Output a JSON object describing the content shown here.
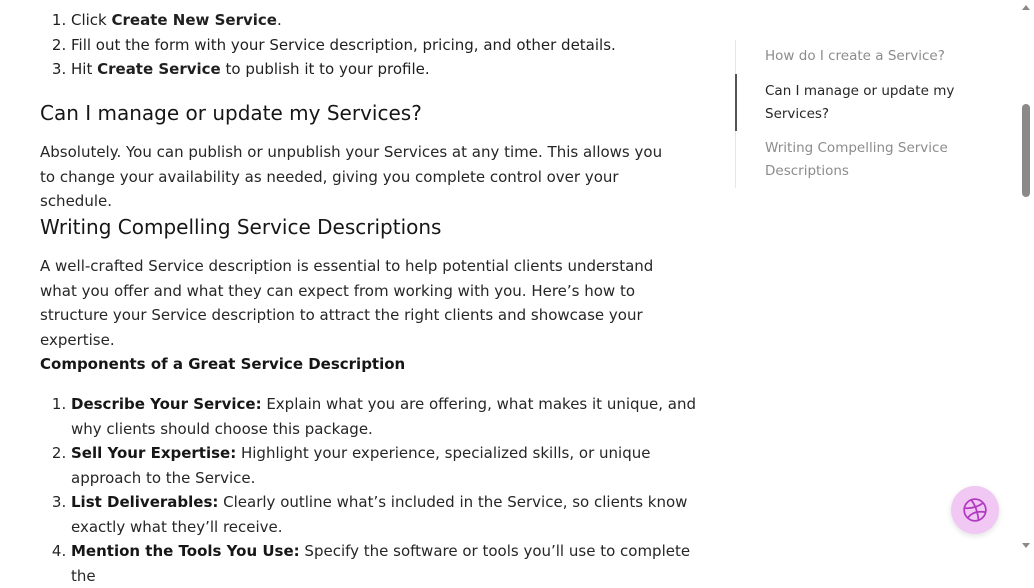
{
  "steps": [
    {
      "prefix": "Click ",
      "bold": "Create New Service",
      "suffix": "."
    },
    {
      "prefix": "Fill out the form with your Service description, pricing, and other details.",
      "bold": "",
      "suffix": ""
    },
    {
      "prefix": "Hit ",
      "bold": "Create Service",
      "suffix": " to publish it to your profile."
    }
  ],
  "sections": {
    "manage": {
      "heading": "Can I manage or update my Services?",
      "body": "Absolutely. You can publish or unpublish your Services at any time. This allows you to change your availability as needed, giving you complete control over your schedule."
    },
    "writing": {
      "heading": "Writing Compelling Service Descriptions",
      "body": "A well-crafted Service description is essential to help potential clients understand what you offer and what they can expect from working with you. Here’s how to structure your Service description to attract the right clients and showcase your expertise."
    },
    "components": {
      "heading": "Components of a Great Service Description",
      "items": [
        {
          "bold": "Describe Your Service:",
          "text": " Explain what you are offering, what makes it unique, and why clients should choose this package."
        },
        {
          "bold": "Sell Your Expertise:",
          "text": " Highlight your experience, specialized skills, or unique approach to the Service."
        },
        {
          "bold": "List Deliverables:",
          "text": " Clearly outline what’s included in the Service, so clients know exactly what they’ll receive."
        },
        {
          "bold": "Mention the Tools You Use:",
          "text": " Specify the software or tools you’ll use to complete the"
        }
      ]
    }
  },
  "toc": {
    "items": [
      {
        "label": "How do I create a Service?",
        "active": false
      },
      {
        "label": "Can I manage or update my Services?",
        "active": true
      },
      {
        "label": "Writing Compelling Service Descriptions",
        "active": false
      }
    ]
  },
  "fab": {
    "icon": "dribbble-icon",
    "color": "#f0c8f3",
    "icon_color": "#b23ac2"
  }
}
